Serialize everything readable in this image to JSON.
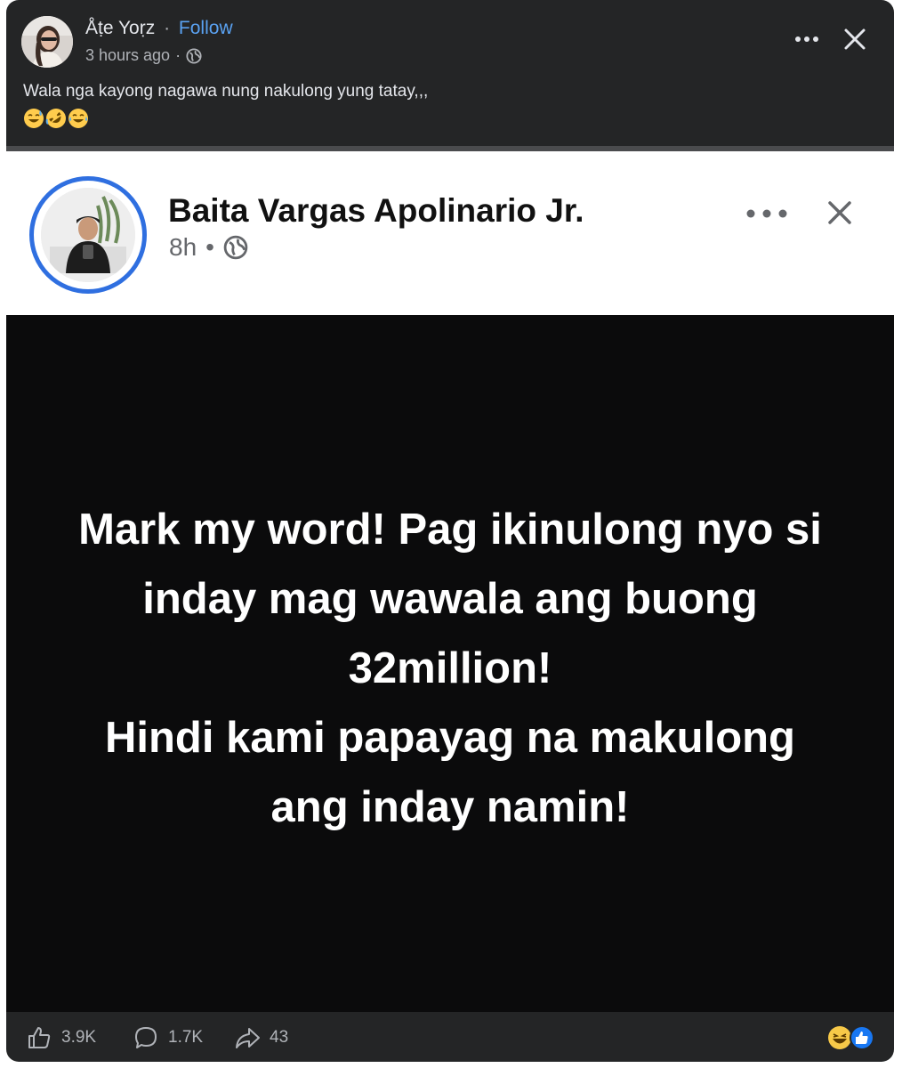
{
  "post": {
    "author": "Åṭe Yoṛz",
    "separator": "·",
    "follow_label": "Follow",
    "timestamp": "3 hours ago",
    "meta_separator": "·",
    "caption": "Wala nga kayong nagawa nung nakulong yung tatay,,,",
    "emojis": [
      "sweat-smile-emoji",
      "rofl-emoji",
      "joy-emoji"
    ]
  },
  "shared": {
    "author": "Baita Vargas Apolinario Jr.",
    "age": "8h",
    "separator": "•",
    "message_lines": [
      "Mark my word! Pag ikinulong nyo si",
      "inday mag wawala ang buong",
      "32million!",
      "Hindi kami papayag na makulong",
      "ang inday namin!"
    ]
  },
  "footer": {
    "likes": "3.9K",
    "comments": "1.7K",
    "shares": "43",
    "reaction_icons": [
      "haha-reaction-icon",
      "like-reaction-icon"
    ]
  },
  "colors": {
    "card_bg": "#242526",
    "accent_link": "#5aa2f2",
    "ring_blue": "#2f6fe0",
    "secondary_text": "#b0b3b8"
  }
}
